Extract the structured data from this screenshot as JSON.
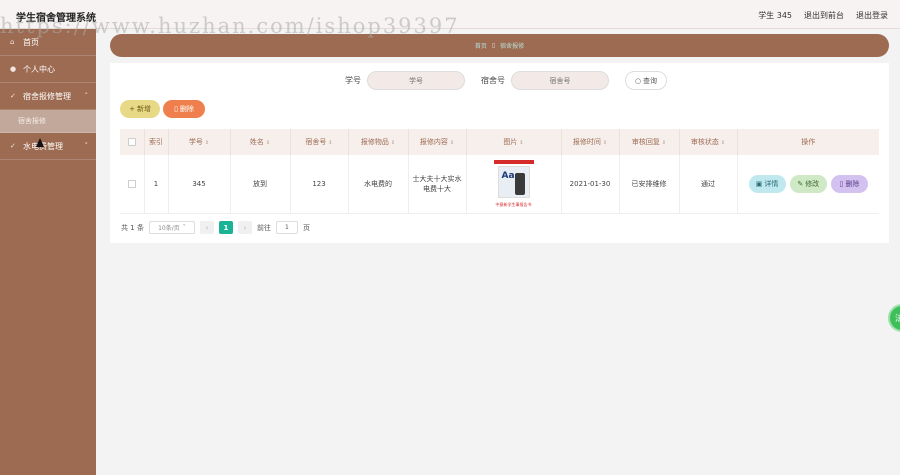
{
  "app_title": "学生宿舍管理系统",
  "watermark": "https://www.huzhan.com/ishop39397",
  "header": {
    "user": "学生 345",
    "back_to_front": "退出到前台",
    "logout": "退出登录"
  },
  "sidebar": {
    "items": [
      {
        "label": "首页",
        "icon": "home-icon"
      },
      {
        "label": "个人中心",
        "icon": "user-icon"
      },
      {
        "label": "宿舍报修管理",
        "icon": "wrench-icon",
        "expanded": true,
        "sub": [
          "宿舍报修"
        ]
      },
      {
        "label": "水电费管理",
        "icon": "wrench-icon"
      }
    ]
  },
  "breadcrumb": {
    "home": "首页",
    "current": "宿舍报修"
  },
  "search": {
    "student_label": "学号",
    "student_placeholder": "学号",
    "dorm_label": "宿舍号",
    "dorm_placeholder": "宿舍号",
    "button": "查询"
  },
  "toolbar": {
    "add": "新增",
    "delete": "删除"
  },
  "table": {
    "columns": [
      "索引",
      "学号",
      "姓名",
      "宿舍号",
      "报修物品",
      "报修内容",
      "图片",
      "报修时间",
      "审核回复",
      "审核状态",
      "操作"
    ],
    "rows": [
      {
        "index": "1",
        "student_no": "345",
        "name": "放到",
        "dorm_no": "123",
        "item": "水电费的",
        "content": "士大夫十大实水电费十大",
        "image_caption": "中意新学生事报告书",
        "time": "2021-01-30",
        "reply": "已安排维修",
        "status": "通过",
        "actions": {
          "detail": "详情",
          "edit": "修改",
          "delete": "删除"
        }
      }
    ]
  },
  "pagination": {
    "total_prefix": "共",
    "total": "1",
    "total_suffix": "条",
    "page_size": "10条/页",
    "current_page": "1",
    "goto_label": "前往",
    "goto_value": "1",
    "page_unit": "页"
  },
  "float_button": "法"
}
